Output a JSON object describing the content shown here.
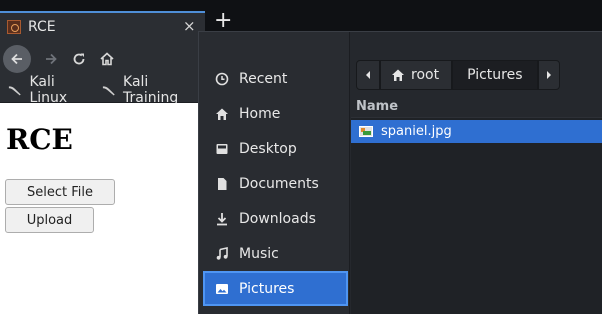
{
  "browser": {
    "tab": {
      "title": "RCE",
      "close_glyph": "×"
    },
    "new_tab_glyph": "+",
    "nav": {
      "back": "back-arrow",
      "forward": "forward-arrow",
      "reload": "reload",
      "home": "home"
    },
    "bookmarks": [
      {
        "label": "Kali Linux",
        "icon": "kali-dragon-icon"
      },
      {
        "label": "Kali Training",
        "icon": "kali-dragon-icon"
      }
    ],
    "page": {
      "heading": "RCE",
      "select_file_label": "Select File",
      "upload_label": "Upload"
    }
  },
  "file_dialog": {
    "places": [
      {
        "label": "Recent",
        "icon": "clock-icon"
      },
      {
        "label": "Home",
        "icon": "home-icon"
      },
      {
        "label": "Desktop",
        "icon": "desktop-icon"
      },
      {
        "label": "Documents",
        "icon": "document-icon"
      },
      {
        "label": "Downloads",
        "icon": "download-icon"
      },
      {
        "label": "Music",
        "icon": "music-icon"
      },
      {
        "label": "Pictures",
        "icon": "pictures-icon",
        "selected": true
      }
    ],
    "pathbar": {
      "segments": [
        "root",
        "Pictures"
      ],
      "current": "Pictures"
    },
    "column_header": "Name",
    "files": [
      {
        "name": "spaniel.jpg",
        "selected": true
      }
    ]
  },
  "colors": {
    "accent": "#2f6fd1",
    "dialog_bg": "#25282d",
    "page_bg": "#ffffff"
  }
}
